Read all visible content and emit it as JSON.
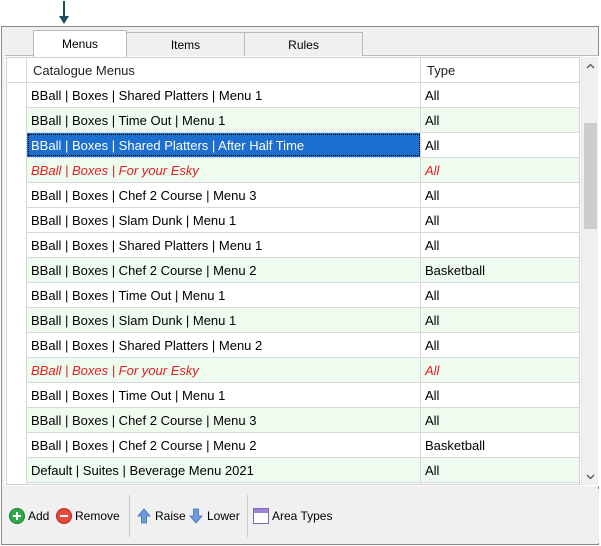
{
  "tabs": [
    {
      "label": "Menus"
    },
    {
      "label": "Items"
    },
    {
      "label": "Rules"
    }
  ],
  "grid": {
    "columns": [
      "Catalogue Menus",
      "Type"
    ],
    "rows": [
      {
        "menu": "BBall | Boxes | Shared Platters | Menu 1",
        "type": "All"
      },
      {
        "menu": "BBall | Boxes | Time Out | Menu 1",
        "type": "All"
      },
      {
        "menu": "BBall | Boxes | Shared Platters | After Half Time",
        "type": "All"
      },
      {
        "menu": "BBall | Boxes | For your Esky",
        "type": "All"
      },
      {
        "menu": "BBall | Boxes | Chef 2 Course | Menu 3",
        "type": "All"
      },
      {
        "menu": "BBall | Boxes | Slam Dunk | Menu 1",
        "type": "All"
      },
      {
        "menu": "BBall | Boxes | Shared Platters | Menu 1",
        "type": "All"
      },
      {
        "menu": "BBall | Boxes | Chef 2 Course | Menu 2",
        "type": "Basketball"
      },
      {
        "menu": "BBall | Boxes | Time Out | Menu 1",
        "type": "All"
      },
      {
        "menu": "BBall | Boxes | Slam Dunk | Menu 1",
        "type": "All"
      },
      {
        "menu": "BBall | Boxes | Shared Platters | Menu 2",
        "type": "All"
      },
      {
        "menu": "BBall | Boxes | For your Esky",
        "type": "All"
      },
      {
        "menu": "BBall | Boxes | Time Out | Menu 1",
        "type": "All"
      },
      {
        "menu": "BBall | Boxes | Chef 2 Course | Menu 3",
        "type": "All"
      },
      {
        "menu": "BBall | Boxes | Chef 2 Course | Menu 2",
        "type": "Basketball"
      },
      {
        "menu": "Default | Suites | Beverage Menu 2021",
        "type": "All"
      }
    ]
  },
  "toolbar": {
    "add_label": "Add",
    "remove_label": "Remove",
    "raise_label": "Raise",
    "lower_label": "Lower",
    "area_types_label": "Area Types"
  },
  "colors": {
    "selected_row": "#1d6fcf",
    "inactive_row_text": "#e02020",
    "alt_row": "#f0fbf0"
  },
  "icons": {
    "pointer": "arrow-down-icon",
    "add": "plus-circle-icon",
    "remove": "minus-circle-icon",
    "raise": "arrow-up-icon",
    "lower": "arrow-down-icon",
    "area_types": "window-icon"
  }
}
